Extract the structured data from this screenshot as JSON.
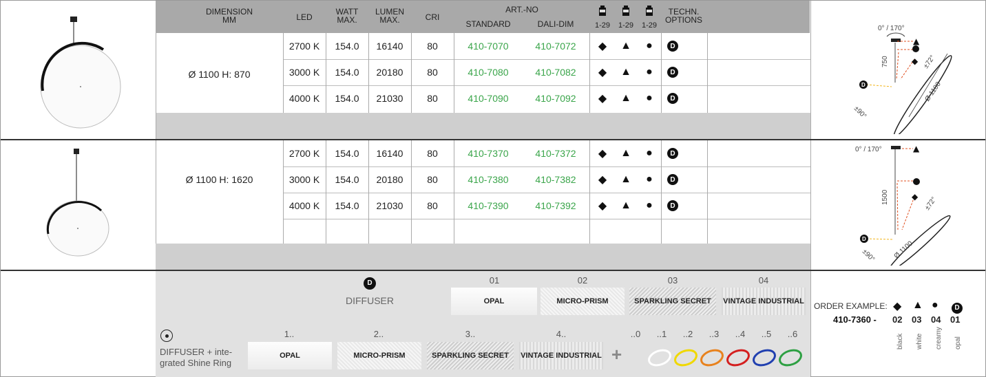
{
  "header": {
    "dimension": "DIMENSION",
    "dimension_unit": "MM",
    "led": "LED",
    "watt_1": "WATT",
    "watt_2": "MAX.",
    "lumen_1": "LUMEN",
    "lumen_2": "MAX.",
    "cri": "CRI",
    "artno": "ART.-NO",
    "standard": "STANDARD",
    "dali": "DALI-DIM",
    "range_1": "1-29",
    "range_2": "1-29",
    "range_3": "1-29",
    "techn_1": "TECHN.",
    "techn_2": "OPTIONS"
  },
  "group1": {
    "dimension": "Ø 1100 H: 870",
    "rows": [
      {
        "led": "2700 K",
        "watt": "154.0",
        "lumen": "16140",
        "cri": "80",
        "std": "410-7070",
        "dali": "410-7072"
      },
      {
        "led": "3000 K",
        "watt": "154.0",
        "lumen": "20180",
        "cri": "80",
        "std": "410-7080",
        "dali": "410-7082"
      },
      {
        "led": "4000 K",
        "watt": "154.0",
        "lumen": "21030",
        "cri": "80",
        "std": "410-7090",
        "dali": "410-7092"
      }
    ],
    "diagram": {
      "angle": "0° / 170°",
      "height": "750",
      "dia": "Ø 1100",
      "tilt": "±90°",
      "deg": "±72°"
    }
  },
  "group2": {
    "dimension": "Ø 1100 H: 1620",
    "rows": [
      {
        "led": "2700 K",
        "watt": "154.0",
        "lumen": "16140",
        "cri": "80",
        "std": "410-7370",
        "dali": "410-7372"
      },
      {
        "led": "3000 K",
        "watt": "154.0",
        "lumen": "20180",
        "cri": "80",
        "std": "410-7380",
        "dali": "410-7382"
      },
      {
        "led": "4000 K",
        "watt": "154.0",
        "lumen": "21030",
        "cri": "80",
        "std": "410-7390",
        "dali": "410-7392"
      }
    ],
    "diagram": {
      "angle": "0° / 170°",
      "height": "1500",
      "dia": "Ø 1100",
      "tilt": "±90°",
      "deg": "±72°"
    }
  },
  "symbols": {
    "diamond": "◆",
    "triangle": "▲",
    "circle": "●",
    "d_badge": "D"
  },
  "diffuser": {
    "title": "DIFFUSER",
    "nums": [
      "01",
      "02",
      "03",
      "04"
    ],
    "options": [
      "OPAL",
      "MICRO-PRISM",
      "SPARKLING SECRET",
      "VINTAGE INDUSTRIAL"
    ]
  },
  "ring": {
    "label_1": "DIFFUSER + inte-",
    "label_2": "grated Shine Ring",
    "nums": [
      "1..",
      "2..",
      "3..",
      "4.."
    ],
    "options": [
      "OPAL",
      "MICRO-PRISM",
      "SPARKLING SECRET",
      "VINTAGE INDUSTRIAL"
    ],
    "plus": "+",
    "ring_nums": [
      "..0",
      "..1",
      "..2",
      "..3",
      "..4",
      "..5",
      "..6"
    ],
    "ring_colors": [
      "#ffffff",
      "#f0d800",
      "#e8821e",
      "#d42020",
      "#2140b0",
      "#2ea043"
    ]
  },
  "order": {
    "label": "ORDER EXAMPLE:",
    "code": "410-7360 -",
    "parts": [
      "02",
      "03",
      "04",
      "01"
    ],
    "legend": [
      "black",
      "white",
      "creamy",
      "opal"
    ]
  },
  "colors": {
    "green": "#3aa54a",
    "header_bg": "#a9a9a9",
    "band": "#cfcfcf"
  }
}
